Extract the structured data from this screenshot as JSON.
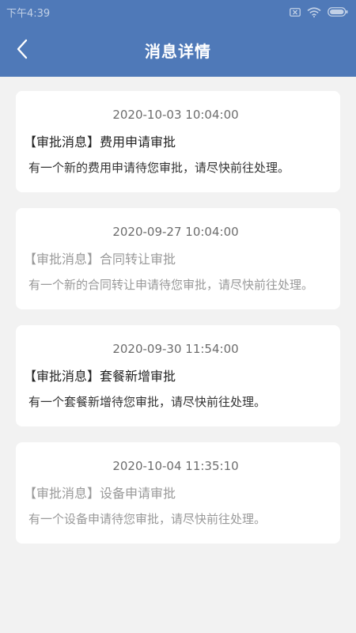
{
  "status_bar": {
    "time": "下午4:39"
  },
  "header": {
    "title": "消息详情"
  },
  "messages": [
    {
      "time": "2020-10-03 10:04:00",
      "title": "【审批消息】费用申请审批",
      "content": "有一个新的费用申请待您审批，请尽快前往处理。",
      "read": false
    },
    {
      "time": "2020-09-27 10:04:00",
      "title": "【审批消息】合同转让审批",
      "content": "有一个新的合同转让申请待您审批，请尽快前往处理。",
      "read": true
    },
    {
      "time": "2020-09-30 11:54:00",
      "title": "【审批消息】套餐新增审批",
      "content": "有一个套餐新增待您审批，请尽快前往处理。",
      "read": false
    },
    {
      "time": "2020-10-04 11:35:10",
      "title": "【审批消息】设备申请审批",
      "content": "有一个设备申请待您审批，请尽快前往处理。",
      "read": true
    }
  ],
  "colors": {
    "header_bg": "#4f79b8",
    "page_bg": "#f2f2f2",
    "read_text": "#999999",
    "unread_text": "#222222"
  },
  "icons": {
    "back": "chevron-left-icon",
    "sim": "sim-card-icon",
    "wifi": "wifi-icon",
    "battery": "battery-icon"
  }
}
